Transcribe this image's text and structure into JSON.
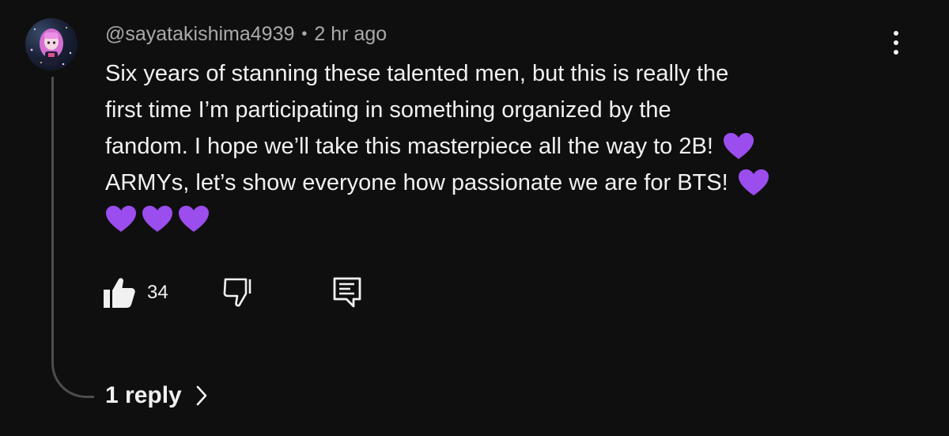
{
  "comment": {
    "author": "@sayatakishima4939",
    "separator": "•",
    "timestamp": "2 hr ago",
    "lines": [
      "Six years of stanning these talented men, but this is really the",
      "first time I’m participating in something organized by the",
      "fandom. I hope we’ll take this masterpiece all the way to 2B!",
      "ARMYs, let’s show everyone how passionate we are for BTS!"
    ],
    "emoji": "💜",
    "like_count": "34",
    "replies_label": "1 reply"
  },
  "icons": {
    "like": "thumbs-up-icon",
    "dislike": "thumbs-down-icon",
    "reply": "comment-reply-icon",
    "more": "more-vertical-icon",
    "chevron": "chevron-right-icon",
    "emoji": "purple-heart-icon"
  },
  "colors": {
    "background": "#0f0f0f",
    "text": "#f1f1f1",
    "secondary_text": "#aaaaaa",
    "thread_line": "#4d4d4d",
    "heart": "#9b4dee"
  }
}
